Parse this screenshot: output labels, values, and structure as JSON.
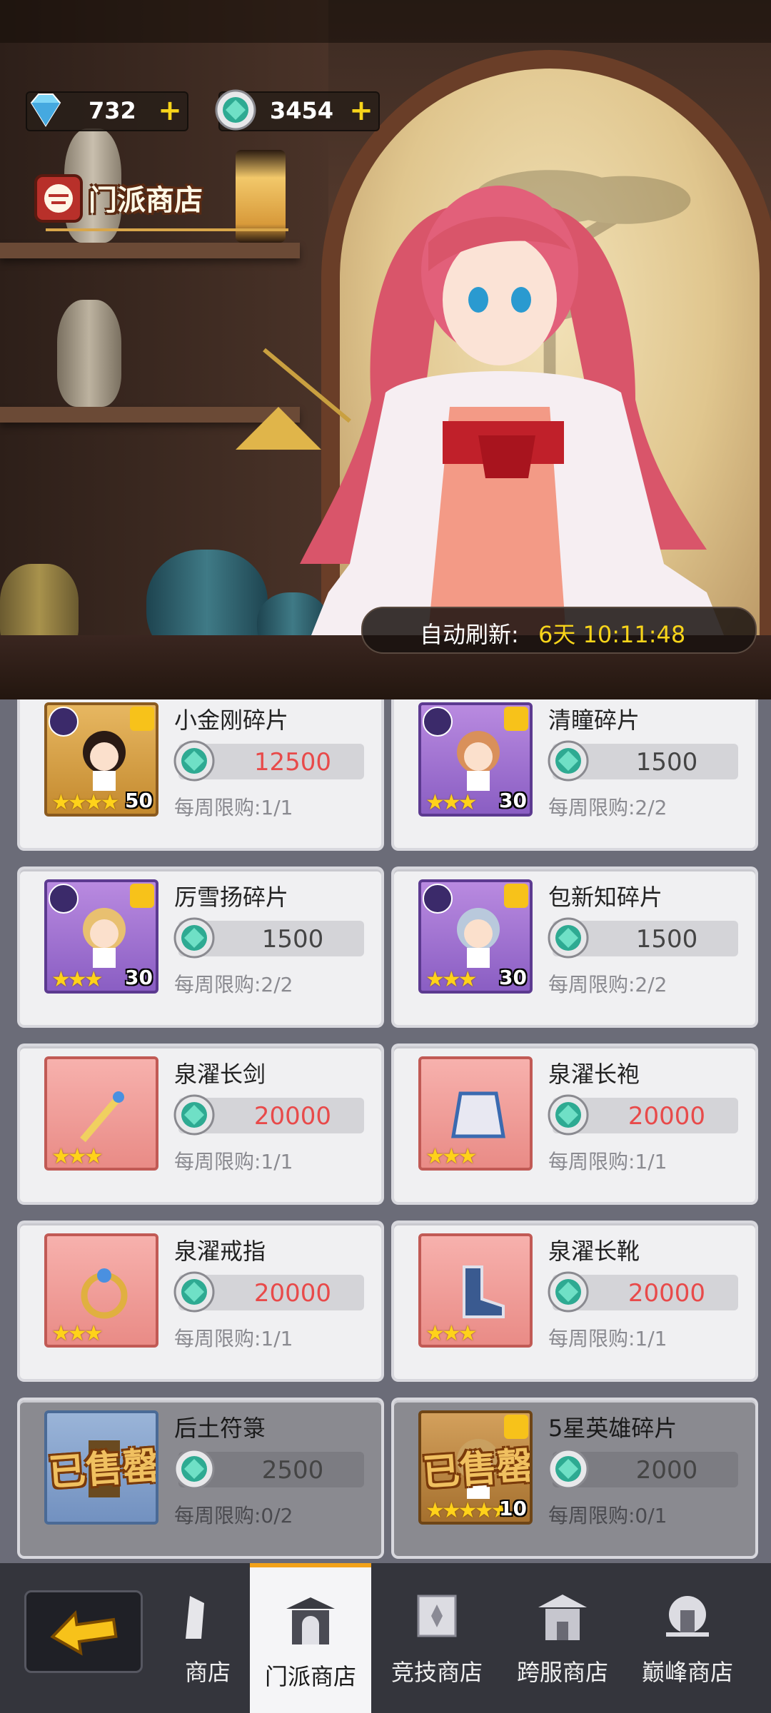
{
  "currency": {
    "gems": "732",
    "coins": "3454"
  },
  "shop_title": "门派商店",
  "refresh": {
    "label": "自动刷新:",
    "time": "6天 10:11:48"
  },
  "items": [
    {
      "name": "小金刚碎片",
      "price": "12500",
      "limit": "每周限购:1/1",
      "stars": "★★★★",
      "count": "50",
      "frame": "gold",
      "price_color": "red",
      "sold": false
    },
    {
      "name": "清瞳碎片",
      "price": "1500",
      "limit": "每周限购:2/2",
      "stars": "★★★",
      "count": "30",
      "frame": "purple",
      "price_color": "dark",
      "sold": false
    },
    {
      "name": "厉雪扬碎片",
      "price": "1500",
      "limit": "每周限购:2/2",
      "stars": "★★★",
      "count": "30",
      "frame": "purple",
      "price_color": "dark",
      "sold": false
    },
    {
      "name": "包新知碎片",
      "price": "1500",
      "limit": "每周限购:2/2",
      "stars": "★★★",
      "count": "30",
      "frame": "purple",
      "price_color": "dark",
      "sold": false
    },
    {
      "name": "泉濯长剑",
      "price": "20000",
      "limit": "每周限购:1/1",
      "stars": "★★★",
      "count": "",
      "frame": "red",
      "price_color": "red",
      "sold": false
    },
    {
      "name": "泉濯长袍",
      "price": "20000",
      "limit": "每周限购:1/1",
      "stars": "★★★",
      "count": "",
      "frame": "red",
      "price_color": "red",
      "sold": false
    },
    {
      "name": "泉濯戒指",
      "price": "20000",
      "limit": "每周限购:1/1",
      "stars": "★★★",
      "count": "",
      "frame": "red",
      "price_color": "red",
      "sold": false
    },
    {
      "name": "泉濯长靴",
      "price": "20000",
      "limit": "每周限购:1/1",
      "stars": "★★★",
      "count": "",
      "frame": "red",
      "price_color": "red",
      "sold": false
    },
    {
      "name": "后土符箓",
      "price": "2500",
      "limit": "每周限购:0/2",
      "stars": "",
      "count": "",
      "frame": "blue",
      "price_color": "dark",
      "sold": true,
      "sold_label": "已售罄"
    },
    {
      "name": "5星英雄碎片",
      "price": "2000",
      "limit": "每周限购:0/1",
      "stars": "★★★★★",
      "count": "10",
      "frame": "bronze",
      "price_color": "dark",
      "sold": true,
      "sold_label": "已售罄"
    }
  ],
  "nav": {
    "tabs": [
      "商店",
      "门派商店",
      "竞技商店",
      "跨服商店",
      "巅峰商店"
    ],
    "active": "门派商店"
  },
  "colors": {
    "accent": "#f7d41a",
    "price_red": "#e84a4a",
    "active_tab_border": "#f2a21a"
  }
}
